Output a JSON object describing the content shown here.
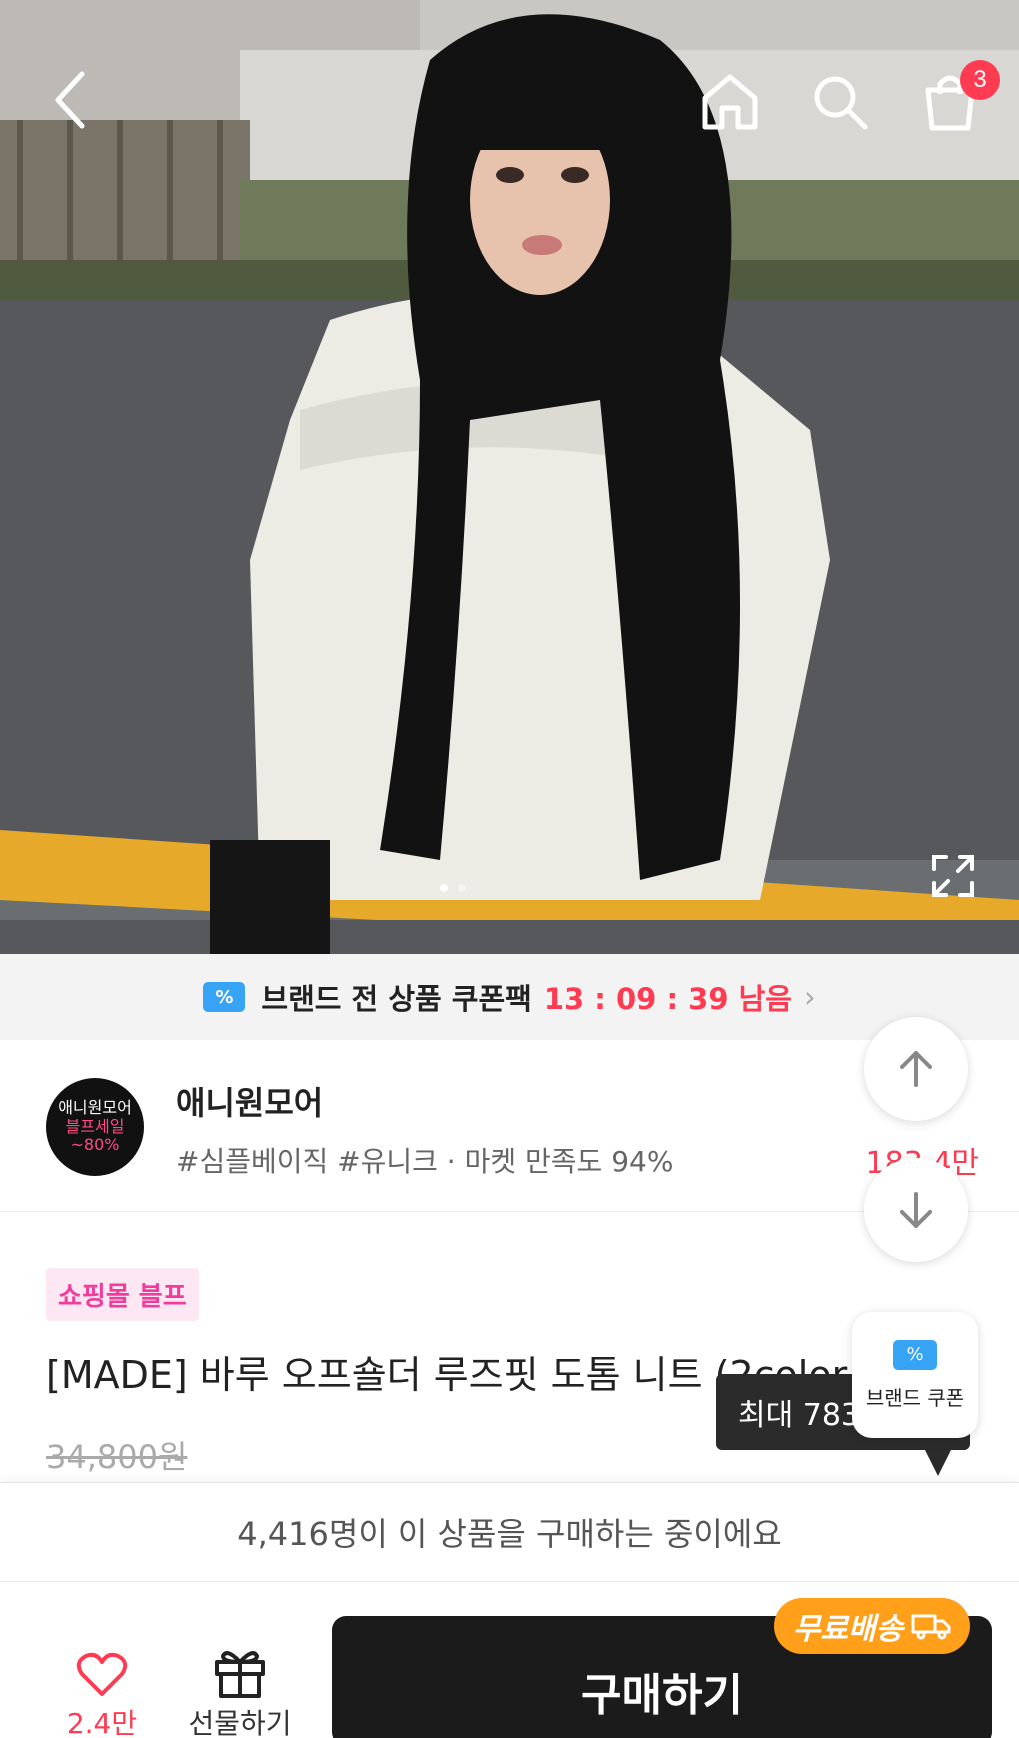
{
  "nav": {
    "back_icon": "chevron-left-icon",
    "home_icon": "home-icon",
    "search_icon": "search-icon",
    "cart_icon": "shopping-bag-icon",
    "cart_badge": "3",
    "expand_icon": "expand-icon"
  },
  "coupon_banner": {
    "label": "브랜드 전 상품 쿠폰팩",
    "timer": "13 : 09 : 39 남음",
    "chevron": "›"
  },
  "brand": {
    "logo_line1": "애니원모어",
    "logo_line2": "블프세일",
    "logo_line3": "~80%",
    "name": "애니원모어",
    "tags": "#심플베이직 #유니크 · 마켓 만족도 94%",
    "like_count": "183.4만"
  },
  "product": {
    "mall_tag": "쇼핑몰 블프",
    "title": "[MADE] 바루 오프숄더 루즈핏 도톰 니트 (2color",
    "original_price": "34,800원",
    "tooltip": "최대 783",
    "brand_coupon_label": "브랜드 쿠폰"
  },
  "notice": {
    "text": "4,416명이 이 상품을 구매하는 중이에요"
  },
  "bottom_bar": {
    "wish_count": "2.4만",
    "gift_label": "선물하기",
    "buy_label": "구매하기",
    "free_shipping": "무료배송"
  },
  "colors": {
    "accent": "#ff3b52",
    "coupon_blue": "#37a3f5",
    "mall_pink": "#f03c9c",
    "free_ship_orange": "#ff9f1a"
  }
}
